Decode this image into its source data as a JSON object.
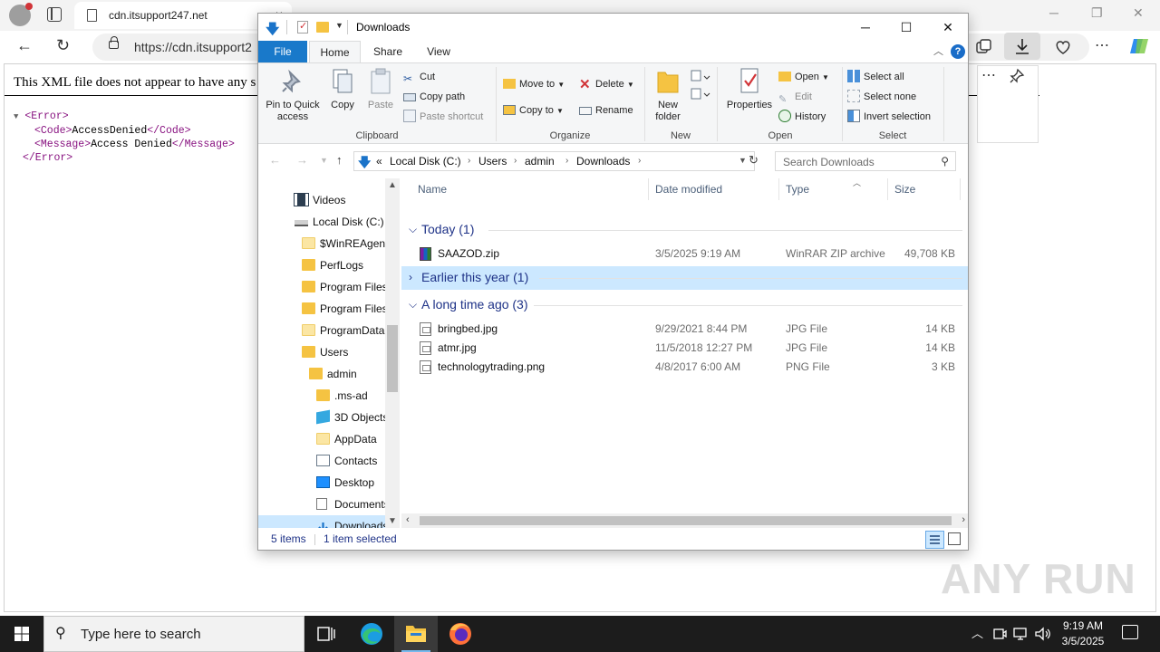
{
  "browser": {
    "tab_title": "cdn.itsupport247.net",
    "tab_close": "×",
    "url": "https://cdn.itsupport2",
    "win_min": "─",
    "win_max": "❐",
    "win_close": "✕",
    "back": "←",
    "reload": "↻",
    "more": "⋯",
    "pin": "📌"
  },
  "xml_page": {
    "notice": "This XML file does not appear to have any s",
    "lines": [
      {
        "open": "<Error>",
        "text": "",
        "close": ""
      },
      {
        "open": "<Code>",
        "text": "AccessDenied",
        "close": "</Code>"
      },
      {
        "open": "<Message>",
        "text": "Access Denied",
        "close": "</Message>"
      },
      {
        "open": "</Error>",
        "text": "",
        "close": ""
      }
    ]
  },
  "explorer": {
    "title": "Downloads",
    "title_controls": {
      "minimize": "─",
      "maximize": "☐",
      "close": "✕"
    },
    "ribbon_tabs": [
      "File",
      "Home",
      "Share",
      "View"
    ],
    "help": "?",
    "ribbon": {
      "clipboard": {
        "label": "Clipboard",
        "pin": "Pin to Quick access",
        "copy": "Copy",
        "paste": "Paste",
        "cut": "Cut",
        "copy_path": "Copy path",
        "paste_shortcut": "Paste shortcut"
      },
      "organize": {
        "label": "Organize",
        "move_to": "Move to",
        "copy_to": "Copy to",
        "delete": "Delete",
        "rename": "Rename"
      },
      "new": {
        "label": "New",
        "new_folder": "New folder"
      },
      "open": {
        "label": "Open",
        "properties": "Properties",
        "open": "Open",
        "edit": "Edit",
        "history": "History"
      },
      "select": {
        "label": "Select",
        "select_all": "Select all",
        "select_none": "Select none",
        "invert": "Invert selection"
      }
    },
    "address": {
      "overflow": "«",
      "segments": [
        "Local Disk (C:)",
        "Users",
        "admin",
        "Downloads"
      ],
      "search_placeholder": "Search Downloads"
    },
    "nav_items": [
      {
        "label": "Videos",
        "icon": "video"
      },
      {
        "label": "Local Disk (C:)",
        "icon": "disk"
      },
      {
        "label": "$WinREAgent",
        "icon": "folder-light"
      },
      {
        "label": "PerfLogs",
        "icon": "folder"
      },
      {
        "label": "Program Files",
        "icon": "folder"
      },
      {
        "label": "Program Files",
        "icon": "folder"
      },
      {
        "label": "ProgramData",
        "icon": "folder-light"
      },
      {
        "label": "Users",
        "icon": "folder"
      },
      {
        "label": "admin",
        "icon": "folder"
      },
      {
        "label": ".ms-ad",
        "icon": "folder"
      },
      {
        "label": "3D Objects",
        "icon": "cube"
      },
      {
        "label": "AppData",
        "icon": "folder-light"
      },
      {
        "label": "Contacts",
        "icon": "contact"
      },
      {
        "label": "Desktop",
        "icon": "desktop"
      },
      {
        "label": "Documents",
        "icon": "doc"
      },
      {
        "label": "Downloads",
        "icon": "dl"
      }
    ],
    "columns": [
      "Name",
      "Date modified",
      "Type",
      "Size"
    ],
    "groups": {
      "today": "Today (1)",
      "earlier": "Earlier this year (1)",
      "long_ago": "A long time ago (3)"
    },
    "files_today": [
      {
        "name": "SAAZOD.zip",
        "date": "3/5/2025 9:19 AM",
        "type": "WinRAR ZIP archive",
        "size": "49,708 KB",
        "icon": "zip"
      }
    ],
    "files_long_ago": [
      {
        "name": "bringbed.jpg",
        "date": "9/29/2021 8:44 PM",
        "type": "JPG File",
        "size": "14 KB",
        "icon": "img"
      },
      {
        "name": "atmr.jpg",
        "date": "11/5/2018 12:27 PM",
        "type": "JPG File",
        "size": "14 KB",
        "icon": "img"
      },
      {
        "name": "technologytrading.png",
        "date": "4/8/2017 6:00 AM",
        "type": "PNG File",
        "size": "3 KB",
        "icon": "img"
      }
    ],
    "status": {
      "count": "5 items",
      "selection": "1 item selected"
    }
  },
  "taskbar": {
    "search_placeholder": "Type here to search",
    "clock_time": "9:19 AM",
    "clock_date": "3/5/2025"
  },
  "watermark": "ANY RUN",
  "colors": {
    "file_tab": "#1979ca",
    "selection": "#cce8ff",
    "group_header": "#1e3287",
    "taskbar": "#1c1c1c"
  }
}
